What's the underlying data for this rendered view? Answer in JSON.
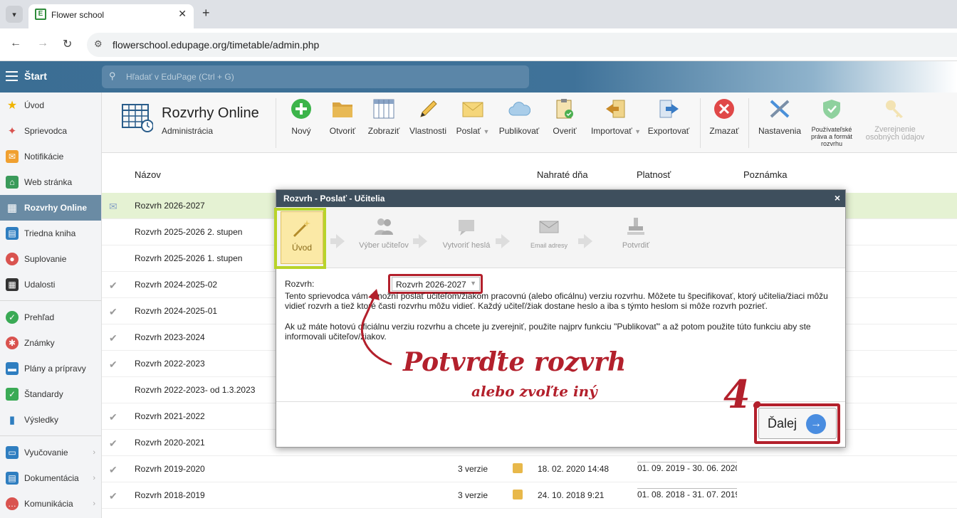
{
  "browser": {
    "tab_title": "Flower school",
    "favicon_letter": "E",
    "url": "flowerschool.edupage.org/timetable/admin.php"
  },
  "appbar": {
    "start_label": "Štart",
    "search_placeholder": "Hľadať v EduPage (Ctrl + G)"
  },
  "sidebar": {
    "items": [
      {
        "label": "Úvod",
        "icon": "star-icon",
        "color": "#f0b400"
      },
      {
        "label": "Sprievodca",
        "icon": "wand-icon",
        "color": "#d9534f"
      },
      {
        "label": "Notifikácie",
        "icon": "envelope-icon",
        "color": "#f0a030"
      },
      {
        "label": "Web stránka",
        "icon": "home-icon",
        "color": "#3a9a5a"
      },
      {
        "label": "Rozvrhy Online",
        "icon": "grid-icon",
        "color": "#ffffff"
      },
      {
        "label": "Triedna kniha",
        "icon": "book-icon",
        "color": "#2f7ec0"
      },
      {
        "label": "Suplovanie",
        "icon": "person-icon",
        "color": "#d9534f"
      },
      {
        "label": "Udalosti",
        "icon": "calendar-icon",
        "color": "#333333"
      },
      {
        "label": "Prehľad",
        "icon": "check-circle-icon",
        "color": "#3aaa55"
      },
      {
        "label": "Známky",
        "icon": "grade-icon",
        "color": "#d9534f"
      },
      {
        "label": "Plány a prípravy",
        "icon": "briefcase-icon",
        "color": "#2f7ec0"
      },
      {
        "label": "Štandardy",
        "icon": "shield-icon",
        "color": "#3aaa55"
      },
      {
        "label": "Výsledky",
        "icon": "bar-chart-icon",
        "color": "#2f7ec0"
      },
      {
        "label": "Vyučovanie",
        "icon": "book-open-icon",
        "color": "#2f7ec0"
      },
      {
        "label": "Dokumentácia",
        "icon": "document-icon",
        "color": "#2f7ec0"
      },
      {
        "label": "Komunikácia",
        "icon": "chat-icon",
        "color": "#d9534f"
      }
    ]
  },
  "module": {
    "title": "Rozvrhy Online",
    "subtitle": "Administrácia"
  },
  "toolbar": {
    "buttons": [
      {
        "label": "Nový",
        "icon": "plus-circle-icon"
      },
      {
        "label": "Otvoriť",
        "icon": "folder-icon"
      },
      {
        "label": "Zobraziť",
        "icon": "table-icon"
      },
      {
        "label": "Vlastnosti",
        "icon": "pencil-icon"
      },
      {
        "label": "Poslať",
        "icon": "envelope-icon"
      },
      {
        "label": "Publikovať",
        "icon": "cloud-icon"
      },
      {
        "label": "Overiť",
        "icon": "clipboard-check-icon"
      },
      {
        "label": "Importovať",
        "icon": "import-icon"
      },
      {
        "label": "Exportovať",
        "icon": "export-icon"
      },
      {
        "label": "Zmazať",
        "icon": "delete-icon"
      },
      {
        "label": "Nastavenia",
        "icon": "tools-icon"
      },
      {
        "label": "Používateľské práva a formát rozvrhu",
        "icon": "shield-check-icon"
      },
      {
        "label": "Zverejnenie osobných údajov",
        "icon": "key-icon"
      }
    ]
  },
  "table": {
    "headers": {
      "name": "Názov",
      "uploaded": "Nahraté dňa",
      "validity": "Platnosť",
      "note": "Poznámka"
    },
    "rows": [
      {
        "name": "Rozvrh 2026-2027",
        "mark": "envelope",
        "versions": "",
        "uploaded": "",
        "validity": ""
      },
      {
        "name": "Rozvrh 2025-2026 2. stupen",
        "mark": "",
        "versions": "",
        "uploaded": "",
        "validity": ""
      },
      {
        "name": "Rozvrh 2025-2026 1. stupen",
        "mark": "",
        "versions": "",
        "uploaded": "",
        "validity": ""
      },
      {
        "name": "Rozvrh 2024-2025-02",
        "mark": "check",
        "versions": "",
        "uploaded": "",
        "validity": ""
      },
      {
        "name": "Rozvrh 2024-2025-01",
        "mark": "check",
        "versions": "",
        "uploaded": "",
        "validity": ""
      },
      {
        "name": "Rozvrh 2023-2024",
        "mark": "check",
        "versions": "",
        "uploaded": "",
        "validity": ""
      },
      {
        "name": "Rozvrh 2022-2023",
        "mark": "check",
        "versions": "",
        "uploaded": "",
        "validity": ""
      },
      {
        "name": "Rozvrh 2022-2023- od 1.3.2023",
        "mark": "",
        "versions": "",
        "uploaded": "",
        "validity": ""
      },
      {
        "name": "Rozvrh 2021-2022",
        "mark": "check",
        "versions": "",
        "uploaded": "",
        "validity": ""
      },
      {
        "name": "Rozvrh 2020-2021",
        "mark": "check",
        "versions": "",
        "uploaded": "",
        "validity": ""
      },
      {
        "name": "Rozvrh 2019-2020",
        "mark": "check",
        "versions": "3 verzie",
        "uploaded": "18. 02. 2020 14:48",
        "validity": "01. 09. 2019 - 30. 06. 2020"
      },
      {
        "name": "Rozvrh 2018-2019",
        "mark": "check",
        "versions": "3 verzie",
        "uploaded": "24. 10. 2018 9:21",
        "validity": "01. 08. 2018 - 31. 07. 2019"
      }
    ]
  },
  "dialog": {
    "title": "Rozvrh - Poslať - Učitelia",
    "close": "×",
    "steps": [
      {
        "label": "Úvod",
        "icon": "wand-icon"
      },
      {
        "label": "Výber učiteľov",
        "icon": "users-icon"
      },
      {
        "label": "Vytvoriť heslá",
        "icon": "password-icon"
      },
      {
        "label": "Email adresy",
        "icon": "email-icon"
      },
      {
        "label": "Potvrdiť",
        "icon": "stamp-icon"
      }
    ],
    "field_label": "Rozvrh:",
    "selected_timetable": "Rozvrh 2026-2027",
    "paragraph1": "Tento sprievodca vám umožní poslať učiteľom/žiakom pracovnú (alebo oficálnu) verziu rozvrhu. Môžete tu špecifikovať, ktorý učitelia/žiaci môžu vidieť rozvrh a tiež ktoré časti rozvrhu môžu vidieť. Každý učiteľ/žiak dostane heslo a iba s týmto heslom si môže rozvrh pozrieť.",
    "paragraph2": "Ak už máte hotovú oficiálnu verziu rozvrhu a chcete ju zverejniť, použite najprv funkciu \"Publikovať\" a až potom použite túto funkciu aby ste informovali učiteľov/žiakov.",
    "next_label": "Ďalej"
  },
  "annotations": {
    "main": "Potvrďte rozvrh",
    "sub": "alebo zvoľte iný",
    "step_number": "4.",
    "color": "#b3202c"
  }
}
